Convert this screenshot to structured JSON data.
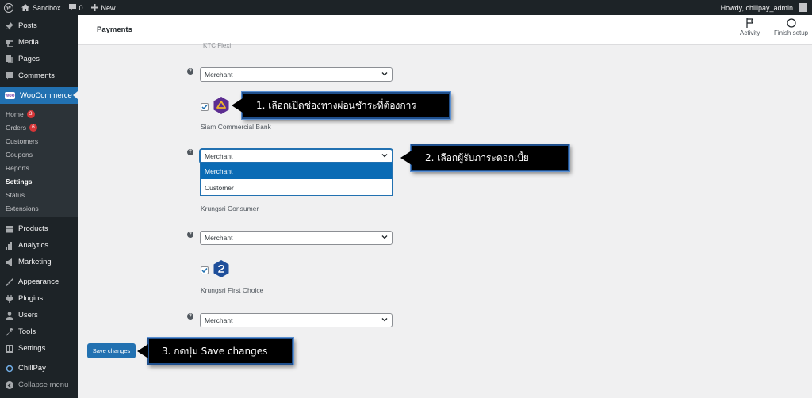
{
  "admin_bar": {
    "site_name": "Sandbox",
    "comment_count": "0",
    "new_label": "New",
    "howdy": "Howdy, chillpay_admin"
  },
  "sidebar": {
    "items_top": [
      {
        "label": "Posts",
        "icon": "pin-icon"
      },
      {
        "label": "Media",
        "icon": "media-icon"
      },
      {
        "label": "Pages",
        "icon": "pages-icon"
      },
      {
        "label": "Comments",
        "icon": "comments-icon"
      }
    ],
    "woocommerce": {
      "label": "WooCommerce",
      "badge": "woo"
    },
    "submenu": [
      {
        "label": "Home",
        "count": "3"
      },
      {
        "label": "Orders",
        "count": "6"
      },
      {
        "label": "Customers"
      },
      {
        "label": "Coupons"
      },
      {
        "label": "Reports"
      },
      {
        "label": "Settings"
      },
      {
        "label": "Status"
      },
      {
        "label": "Extensions"
      }
    ],
    "items_bottom": [
      {
        "label": "Products",
        "icon": "products-icon"
      },
      {
        "label": "Analytics",
        "icon": "analytics-icon"
      },
      {
        "label": "Marketing",
        "icon": "marketing-icon"
      },
      {
        "label": "Appearance",
        "icon": "appearance-icon"
      },
      {
        "label": "Plugins",
        "icon": "plugins-icon"
      },
      {
        "label": "Users",
        "icon": "users-icon"
      },
      {
        "label": "Tools",
        "icon": "tools-icon"
      },
      {
        "label": "Settings",
        "icon": "settings-icon"
      },
      {
        "label": "ChillPay",
        "icon": "chillpay-icon"
      },
      {
        "label": "Collapse menu",
        "icon": "collapse-icon"
      }
    ]
  },
  "header": {
    "title": "Payments",
    "activity_label": "Activity",
    "finish_setup_label": "Finish setup"
  },
  "main": {
    "cut_off_label": "KTC Flexi",
    "select_1": "Merchant",
    "bank_1": "Siam Commercial Bank",
    "select_2": "Merchant",
    "dropdown_options": [
      "Merchant",
      "Customer"
    ],
    "bank_2": "Krungsri Consumer",
    "select_3": "Merchant",
    "bank_3": "Krungsri First Choice",
    "select_4": "Merchant",
    "help_glyph": "?",
    "save_label": "Save changes"
  },
  "callouts": {
    "c1": "1. เลือกเปิดช่องทางผ่อนชำระที่ต้องการ",
    "c2": "2. เลือกผู้รับภาระดอกเบี้ย",
    "c3": "3. กดปุ่ม Save changes"
  },
  "colors": {
    "admin_dark": "#1d2327",
    "primary_blue": "#2271b1",
    "scb_purple": "#5c2d91",
    "krungsri_blue": "#1e4e9a",
    "badge_red": "#d63638"
  }
}
